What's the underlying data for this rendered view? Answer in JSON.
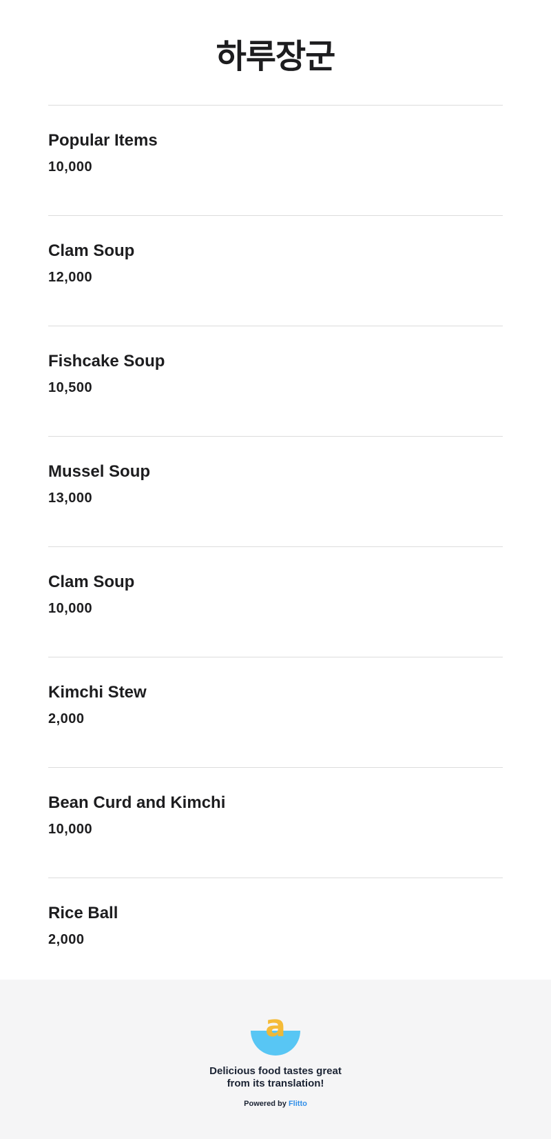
{
  "header": {
    "title": "하루장군"
  },
  "menu": {
    "items": [
      {
        "name": "Popular Items",
        "price": "10,000"
      },
      {
        "name": "Clam Soup",
        "price": "12,000"
      },
      {
        "name": "Fishcake Soup",
        "price": "10,500"
      },
      {
        "name": "Mussel Soup",
        "price": "13,000"
      },
      {
        "name": "Clam Soup",
        "price": "10,000"
      },
      {
        "name": "Kimchi Stew",
        "price": "2,000"
      },
      {
        "name": "Bean Curd and Kimchi",
        "price": "10,000"
      },
      {
        "name": "Rice Ball",
        "price": "2,000"
      }
    ]
  },
  "footer": {
    "logo_icon": "flitto-bowl-logo-icon",
    "logo_letter": "a",
    "tagline_line1": "Delicious food tastes great",
    "tagline_line2": "from its translation!",
    "powered_by": "Powered by",
    "brand": "Flitto"
  },
  "colors": {
    "text": "#1d1d1f",
    "divider": "#dcdcdc",
    "footer_bg": "#f5f5f6",
    "brand_blue": "#2f8ee8",
    "bowl_blue": "#58c6f4",
    "letter_yellow": "#f5b82e"
  }
}
